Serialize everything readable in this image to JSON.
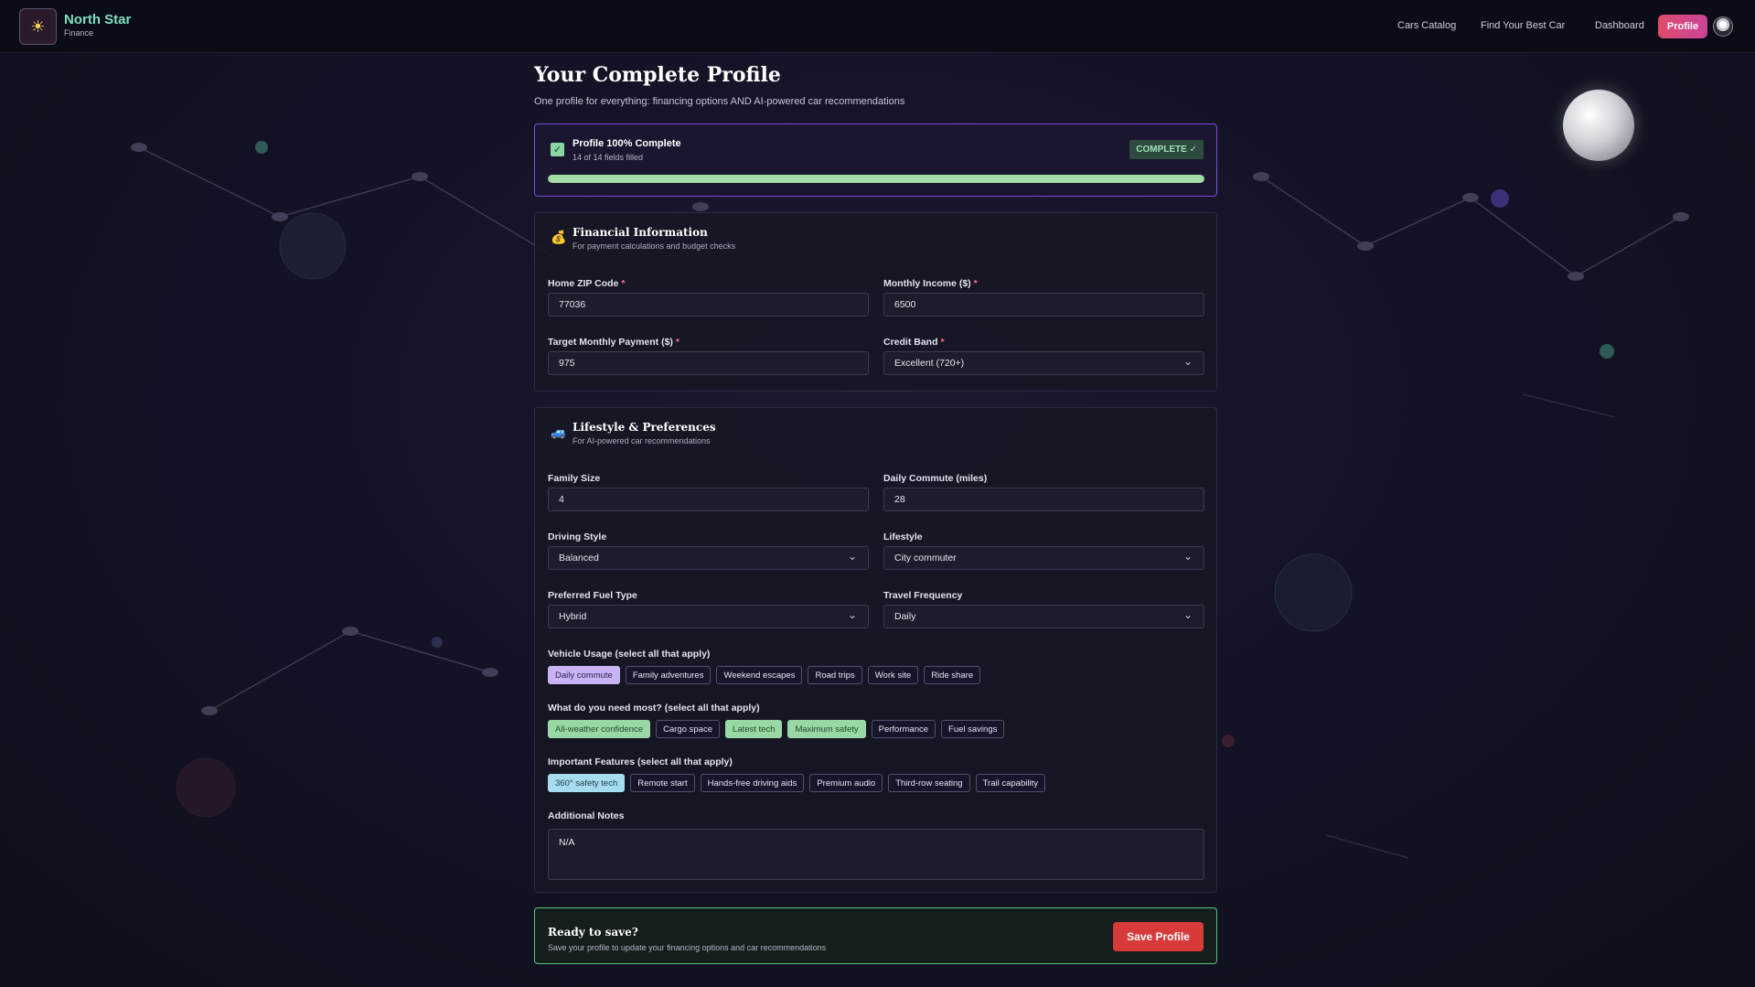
{
  "header": {
    "brand_name": "North Star",
    "brand_sub": "Finance",
    "nav": [
      "Cars Catalog",
      "Find Your Best Car",
      "Dashboard"
    ],
    "profile_label": "Profile"
  },
  "page": {
    "title": "Your Complete Profile",
    "subtitle": "One profile for everything: financing options AND AI-powered car recommendations"
  },
  "completion": {
    "title": "Profile 100% Complete",
    "subtitle": "14 of 14 fields filled",
    "badge": "COMPLETE ✓",
    "progress_percent": 100
  },
  "financial": {
    "icon": "money-bag-icon",
    "title": "Financial Information",
    "subtitle": "For payment calculations and budget checks",
    "zip_label": "Home ZIP Code",
    "zip_value": "77036",
    "income_label": "Monthly Income ($)",
    "income_value": "6500",
    "payment_label": "Target Monthly Payment ($)",
    "payment_value": "975",
    "credit_label": "Credit Band",
    "credit_value": "Excellent (720+)"
  },
  "lifestyle": {
    "icon": "car-icon",
    "title": "Lifestyle & Preferences",
    "subtitle": "For AI-powered car recommendations",
    "family_label": "Family Size",
    "family_value": "4",
    "commute_label": "Daily Commute (miles)",
    "commute_value": "28",
    "driving_label": "Driving Style",
    "driving_value": "Balanced",
    "lifestyle_label": "Lifestyle",
    "lifestyle_value": "City commuter",
    "fuel_label": "Preferred Fuel Type",
    "fuel_value": "Hybrid",
    "travel_label": "Travel Frequency",
    "travel_value": "Daily",
    "usage_label": "Vehicle Usage (select all that apply)",
    "usage": [
      {
        "label": "Daily commute",
        "selected": true
      },
      {
        "label": "Family adventures",
        "selected": false
      },
      {
        "label": "Weekend escapes",
        "selected": false
      },
      {
        "label": "Road trips",
        "selected": false
      },
      {
        "label": "Work site",
        "selected": false
      },
      {
        "label": "Ride share",
        "selected": false
      }
    ],
    "needs_label": "What do you need most? (select all that apply)",
    "needs": [
      {
        "label": "All-weather confidence",
        "selected": true
      },
      {
        "label": "Cargo space",
        "selected": false
      },
      {
        "label": "Latest tech",
        "selected": true
      },
      {
        "label": "Maximum safety",
        "selected": true
      },
      {
        "label": "Performance",
        "selected": false
      },
      {
        "label": "Fuel savings",
        "selected": false
      }
    ],
    "features_label": "Important Features (select all that apply)",
    "features": [
      {
        "label": "360° safety tech",
        "selected": true
      },
      {
        "label": "Remote start",
        "selected": false
      },
      {
        "label": "Hands-free driving aids",
        "selected": false
      },
      {
        "label": "Premium audio",
        "selected": false
      },
      {
        "label": "Third-row seating",
        "selected": false
      },
      {
        "label": "Trail capability",
        "selected": false
      }
    ],
    "notes_label": "Additional Notes",
    "notes_value": "N/A"
  },
  "save": {
    "title": "Ready to save?",
    "subtitle": "Save your profile to update your financing options and car recommendations",
    "button": "Save Profile"
  },
  "colors": {
    "accent_purple": "#7c4ce0",
    "progress_green": "#9fdca8",
    "save_red": "#d83a3a",
    "brand_teal": "#7fe0c0"
  }
}
